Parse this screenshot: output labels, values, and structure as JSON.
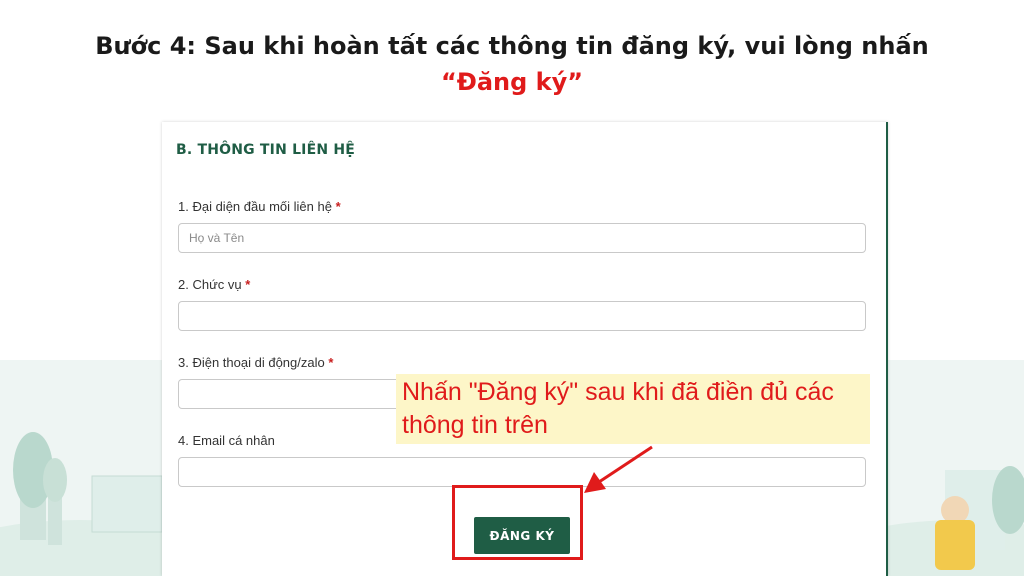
{
  "slide": {
    "title_prefix": "Bước 4: Sau khi hoàn tất các thông tin đăng ký, vui lòng nhấn",
    "title_highlight": "“Đăng ký”"
  },
  "form": {
    "section_heading": "B. THÔNG TIN LIÊN HỆ",
    "required_mark": "*",
    "fields": [
      {
        "label": "1. Đại diện đầu mối liên hệ",
        "required": true,
        "placeholder": "Họ và Tên",
        "value": ""
      },
      {
        "label": "2. Chức vụ",
        "required": true,
        "placeholder": "",
        "value": ""
      },
      {
        "label": "3. Điện thoại di động/zalo",
        "required": true,
        "placeholder": "",
        "value": ""
      },
      {
        "label": "4. Email cá nhân",
        "required": false,
        "placeholder": "",
        "value": ""
      }
    ],
    "submit_label": "ĐĂNG KÝ"
  },
  "callout": {
    "text": "Nhấn \"Đăng ký\" sau khi đã điền đủ các thông tin trên"
  },
  "colors": {
    "accent_green": "#1f5d45",
    "annotation_red": "#e01b1b",
    "callout_bg": "#fdf6c8"
  },
  "icons": {
    "annotation_arrow": "arrow-icon"
  }
}
